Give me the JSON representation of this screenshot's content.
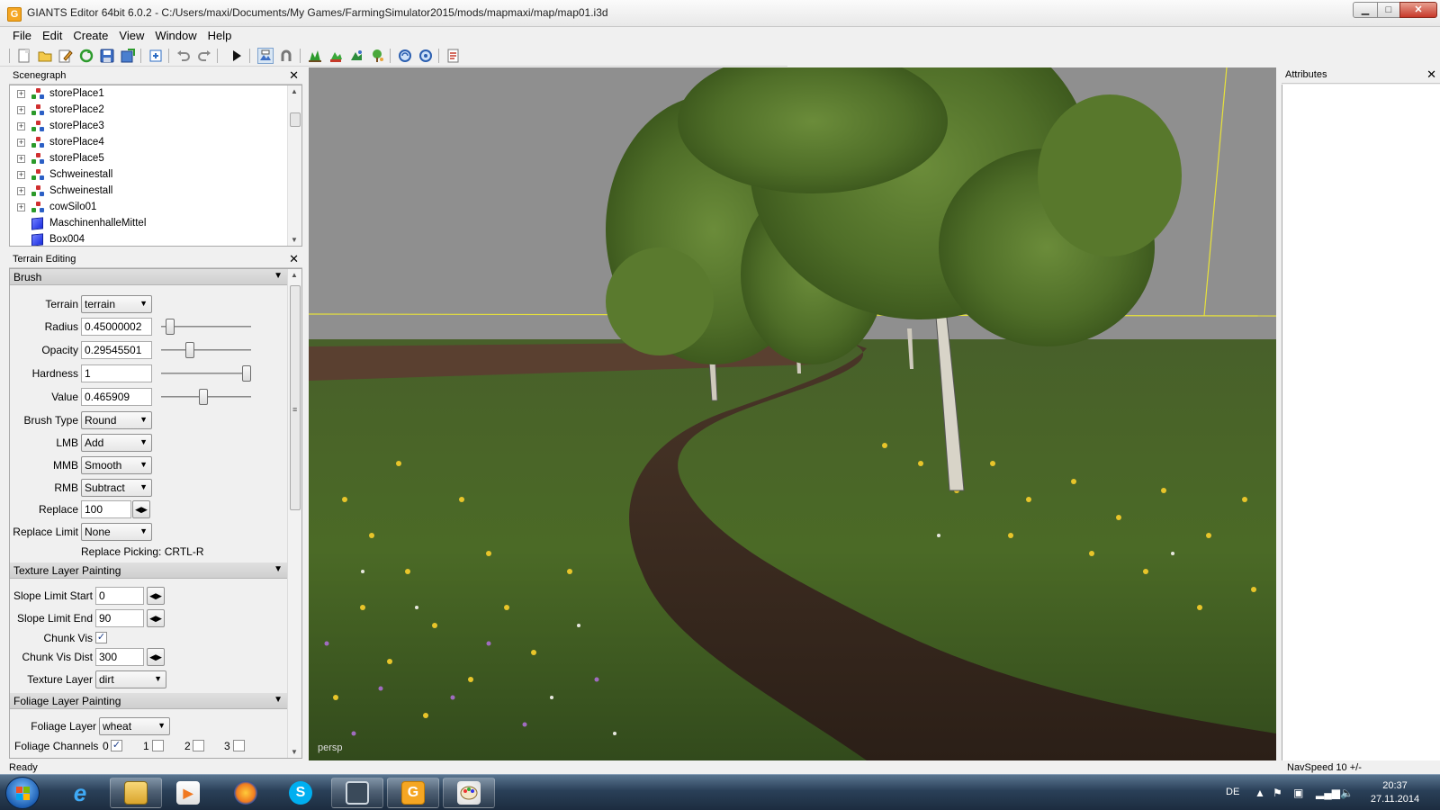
{
  "window": {
    "title": "GIANTS Editor 64bit 6.0.2 - C:/Users/maxi/Documents/My Games/FarmingSimulator2015/mods/mapmaxi/map/map01.i3d",
    "app_icon_letter": "G"
  },
  "menu": [
    "File",
    "Edit",
    "Create",
    "View",
    "Window",
    "Help"
  ],
  "scenegraph": {
    "title": "Scenegraph",
    "items": [
      {
        "label": "storePlace1",
        "type": "node"
      },
      {
        "label": "storePlace2",
        "type": "node"
      },
      {
        "label": "storePlace3",
        "type": "node"
      },
      {
        "label": "storePlace4",
        "type": "node"
      },
      {
        "label": "storePlace5",
        "type": "node"
      },
      {
        "label": "Schweinestall",
        "type": "node"
      },
      {
        "label": "Schweinestall",
        "type": "node"
      },
      {
        "label": "cowSilo01",
        "type": "node"
      },
      {
        "label": "MaschinenhalleMittel",
        "type": "box"
      },
      {
        "label": "Box004",
        "type": "box"
      }
    ]
  },
  "terrain": {
    "title": "Terrain Editing",
    "brush": {
      "section": "Brush",
      "terrain_label": "Terrain",
      "terrain_value": "terrain",
      "radius_label": "Radius",
      "radius_value": "0.45000002",
      "radius_slider": 0.05,
      "opacity_label": "Opacity",
      "opacity_value": "0.29545501",
      "opacity_slider": 0.3,
      "hardness_label": "Hardness",
      "hardness_value": "1",
      "hardness_slider": 1.0,
      "value_label": "Value",
      "value_value": "0.465909",
      "value_slider": 0.47,
      "brushtype_label": "Brush Type",
      "brushtype_value": "Round",
      "lmb_label": "LMB",
      "lmb_value": "Add",
      "mmb_label": "MMB",
      "mmb_value": "Smooth",
      "rmb_label": "RMB",
      "rmb_value": "Subtract",
      "replace_label": "Replace",
      "replace_value": "100",
      "replacelimit_label": "Replace Limit",
      "replacelimit_value": "None",
      "replace_picking": "Replace Picking: CRTL-R"
    },
    "texture": {
      "section": "Texture Layer Painting",
      "slope_start_label": "Slope Limit Start",
      "slope_start_value": "0",
      "slope_end_label": "Slope Limit End",
      "slope_end_value": "90",
      "chunk_vis_label": "Chunk Vis",
      "chunk_vis_checked": "✓",
      "chunk_dist_label": "Chunk Vis Dist",
      "chunk_dist_value": "300",
      "layer_label": "Texture Layer",
      "layer_value": "dirt"
    },
    "foliage": {
      "section": "Foliage Layer Painting",
      "layer_label": "Foliage Layer",
      "layer_value": "wheat",
      "channels_label": "Foliage Channels",
      "channels": [
        {
          "label": "0",
          "checked": "✓"
        },
        {
          "label": "1",
          "checked": ""
        },
        {
          "label": "2",
          "checked": ""
        },
        {
          "label": "3",
          "checked": ""
        }
      ]
    }
  },
  "viewport": {
    "camera_label": "persp"
  },
  "attributes": {
    "title": "Attributes"
  },
  "status": {
    "left": "Ready",
    "right": "NavSpeed 10 +/-"
  },
  "taskbar": {
    "language": "DE",
    "time": "20:37",
    "date": "27.11.2014"
  },
  "colors": {
    "accent": "#3a6ea5",
    "sky": "#8f8f8f",
    "grass": "#4e6b2a",
    "path": "#3e2d22",
    "foliage": "#5e7f31"
  }
}
